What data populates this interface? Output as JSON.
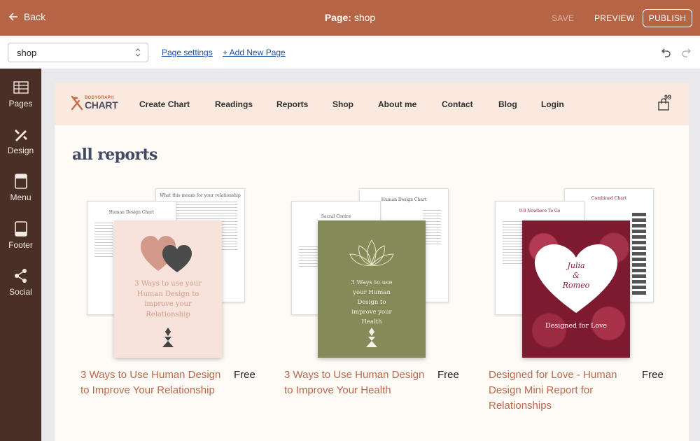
{
  "topbar": {
    "back_label": "Back",
    "title_prefix": "Page:",
    "title_value": " shop",
    "save_label": "SAVE",
    "preview_label": "PREVIEW",
    "publish_label": "PUBLISH"
  },
  "toolbar": {
    "page_select_value": "shop",
    "page_settings_label": "Page settings",
    "add_page_label": "+ Add New Page"
  },
  "sidebar": {
    "items": [
      {
        "label": "Pages",
        "icon": "pages-icon"
      },
      {
        "label": "Design",
        "icon": "design-icon"
      },
      {
        "label": "Menu",
        "icon": "menu-icon"
      },
      {
        "label": "Footer",
        "icon": "footer-icon"
      },
      {
        "label": "Social",
        "icon": "share-icon"
      }
    ]
  },
  "site": {
    "logo_top": "BODYGRAPH",
    "logo_main": "CHART",
    "nav": [
      "Create Chart",
      "Readings",
      "Reports",
      "Shop",
      "About me",
      "Contact",
      "Blog",
      "Login"
    ],
    "cart_count": "99",
    "section_title": "all reports"
  },
  "products": [
    {
      "title": "3 Ways to Use Human Design to Improve Your Relationship",
      "price": "Free",
      "doc_left_title": "Human Design Chart",
      "doc_right_title": "What this means for your relationship",
      "cover_text": "3 Ways to use your Human Design to improve your Relationship",
      "cover_color": "#f7e2dc",
      "cover_text_color": "#d19c86"
    },
    {
      "title": "3 Ways to Use Human Design to Improve Your Health",
      "price": "Free",
      "doc_left_title": "Sacral Centre",
      "doc_right_title": "Human Design Chart",
      "cover_text": "3 Ways to use your Human Design to improve your Health",
      "cover_color": "#858a59",
      "cover_text_color": "#f4f1e6"
    },
    {
      "title": "Designed for Love - Human Design Mini Report for Relationships",
      "price": "Free",
      "doc_left_title": "9-0 Nowhere To Go",
      "doc_right_title": "Combined Chart",
      "cover_heart_line1": "Julia",
      "cover_heart_line2": "&",
      "cover_heart_line3": "Romeo",
      "cover_text": "Designed for Love",
      "cover_color": "#8a1d33",
      "cover_text_color": "#ffffff"
    }
  ],
  "colors": {
    "topbar": "#b66446",
    "sidebar": "#4a2f27",
    "site_nav": "#fbe9df",
    "link": "#1c4fa8",
    "product_title": "#b9694b"
  }
}
